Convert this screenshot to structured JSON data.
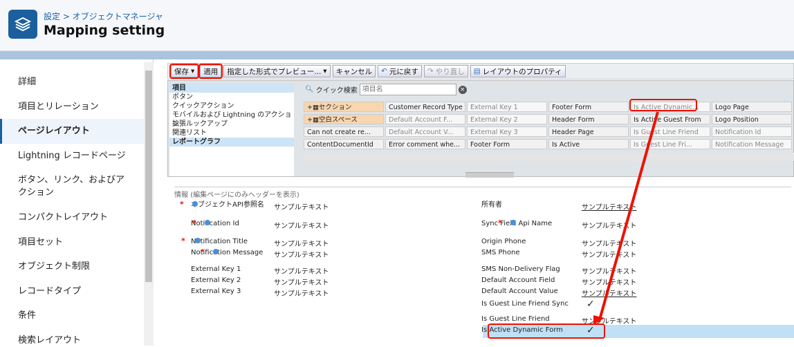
{
  "header": {
    "breadcrumb": "設定 > オブジェクトマネージャ",
    "title": "Mapping setting",
    "logo": "layers-icon"
  },
  "sidebar": {
    "items": [
      {
        "label": "詳細"
      },
      {
        "label": "項目とリレーション"
      },
      {
        "label": "ページレイアウト"
      },
      {
        "label": "Lightning レコードページ"
      },
      {
        "label": "ボタン、リンク、およびアクション"
      },
      {
        "label": "コンパクトレイアウト"
      },
      {
        "label": "項目セット"
      },
      {
        "label": "オブジェクト制限"
      },
      {
        "label": "レコードタイプ"
      },
      {
        "label": "条件"
      },
      {
        "label": "検索レイアウト"
      }
    ]
  },
  "toolbar": {
    "save": "保存",
    "apply": "適用",
    "preview": "指定した形式でプレビュー...",
    "cancel": "キャンセル",
    "undo": "元に戻す",
    "redo": "やり直し",
    "props": "レイアウトのプロパティ"
  },
  "palette": {
    "categories": [
      "項目",
      "ボタン",
      "クイックアクション",
      "モバイルおよび Lightning のアクション",
      "拡張ルックアップ",
      "関連リスト",
      "レポートグラフ"
    ],
    "quick_search_label": "クイック検索",
    "quick_search_placeholder": "項目名",
    "cells": [
      [
        "セクション",
        "Customer Record Type",
        "External Key 1",
        "Footer Form",
        "Is Active Dynamic...",
        "Logo Page"
      ],
      [
        "空白スペース",
        "Default Account F...",
        "External Key 2",
        "Header Form",
        "Is Active Guest From",
        "Logo Position"
      ],
      [
        "Can not create re...",
        "Default Account V...",
        "External Key 3",
        "Header Page",
        "Is Guest Line Friend",
        "Notification Id"
      ],
      [
        "ContentDocumentId",
        "Error comment whe...",
        "Footer Form",
        "Is Active",
        "Is Guest Line Fri...",
        "Notification Message"
      ]
    ]
  },
  "layout": {
    "section_title": "情報 (編集ページにのみヘッダーを表示)",
    "sample": "サンプルテキスト",
    "left": [
      "オブジェクトAPI参照名",
      "Notification Id",
      "Notification Title",
      "Notification Message",
      "External Key 1",
      "External Key 2",
      "External Key 3"
    ],
    "right": [
      "所有者",
      "Sync Field Api Name",
      "Origin Phone",
      "SMS Phone",
      "SMS Non-Delivery Flag",
      "Default Account Field",
      "Default Account Value",
      "Is Guest Line Friend Sync",
      "Is Guest Line Friend",
      "Is Active Dynamic Form"
    ],
    "check": "✓"
  }
}
